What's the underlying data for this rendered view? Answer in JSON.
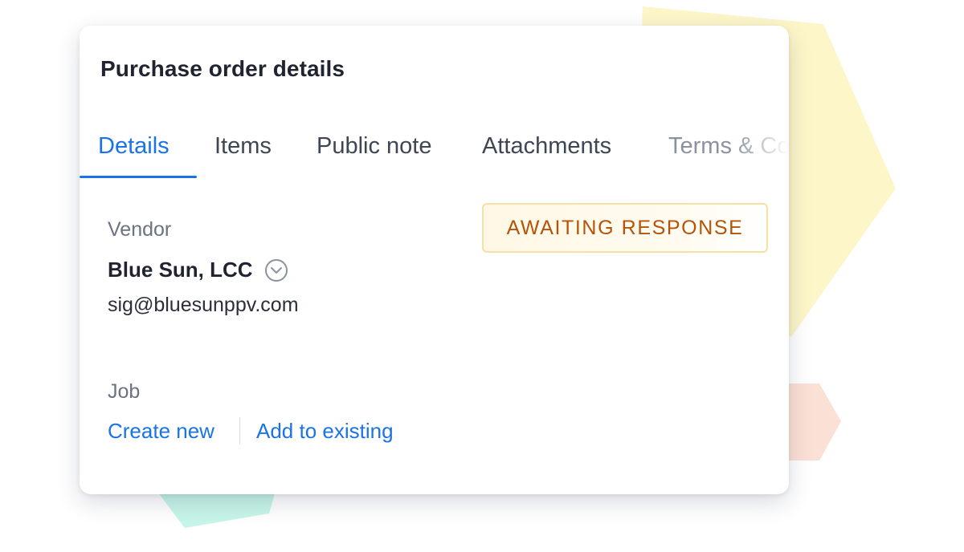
{
  "card": {
    "title": "Purchase order details"
  },
  "tabs": [
    {
      "label": "Details",
      "active": true
    },
    {
      "label": "Items",
      "active": false
    },
    {
      "label": "Public note",
      "active": false
    },
    {
      "label": "Attachments",
      "active": false
    },
    {
      "label": "Terms & Co",
      "active": false
    }
  ],
  "vendor": {
    "label": "Vendor",
    "name": "Blue Sun, LCC",
    "email": "sig@bluesunppv.com",
    "dropdown_icon": "chevron-down-circle-icon"
  },
  "status": {
    "text": "AWAITING RESPONSE",
    "color": "#b45309",
    "background": "#fff8e6",
    "border": "#f6e1a4"
  },
  "job": {
    "label": "Job",
    "create_new_label": "Create new",
    "add_existing_label": "Add to existing"
  },
  "colors": {
    "accent": "#1a73e8",
    "title": "#1f2430",
    "muted": "#6b7280"
  }
}
